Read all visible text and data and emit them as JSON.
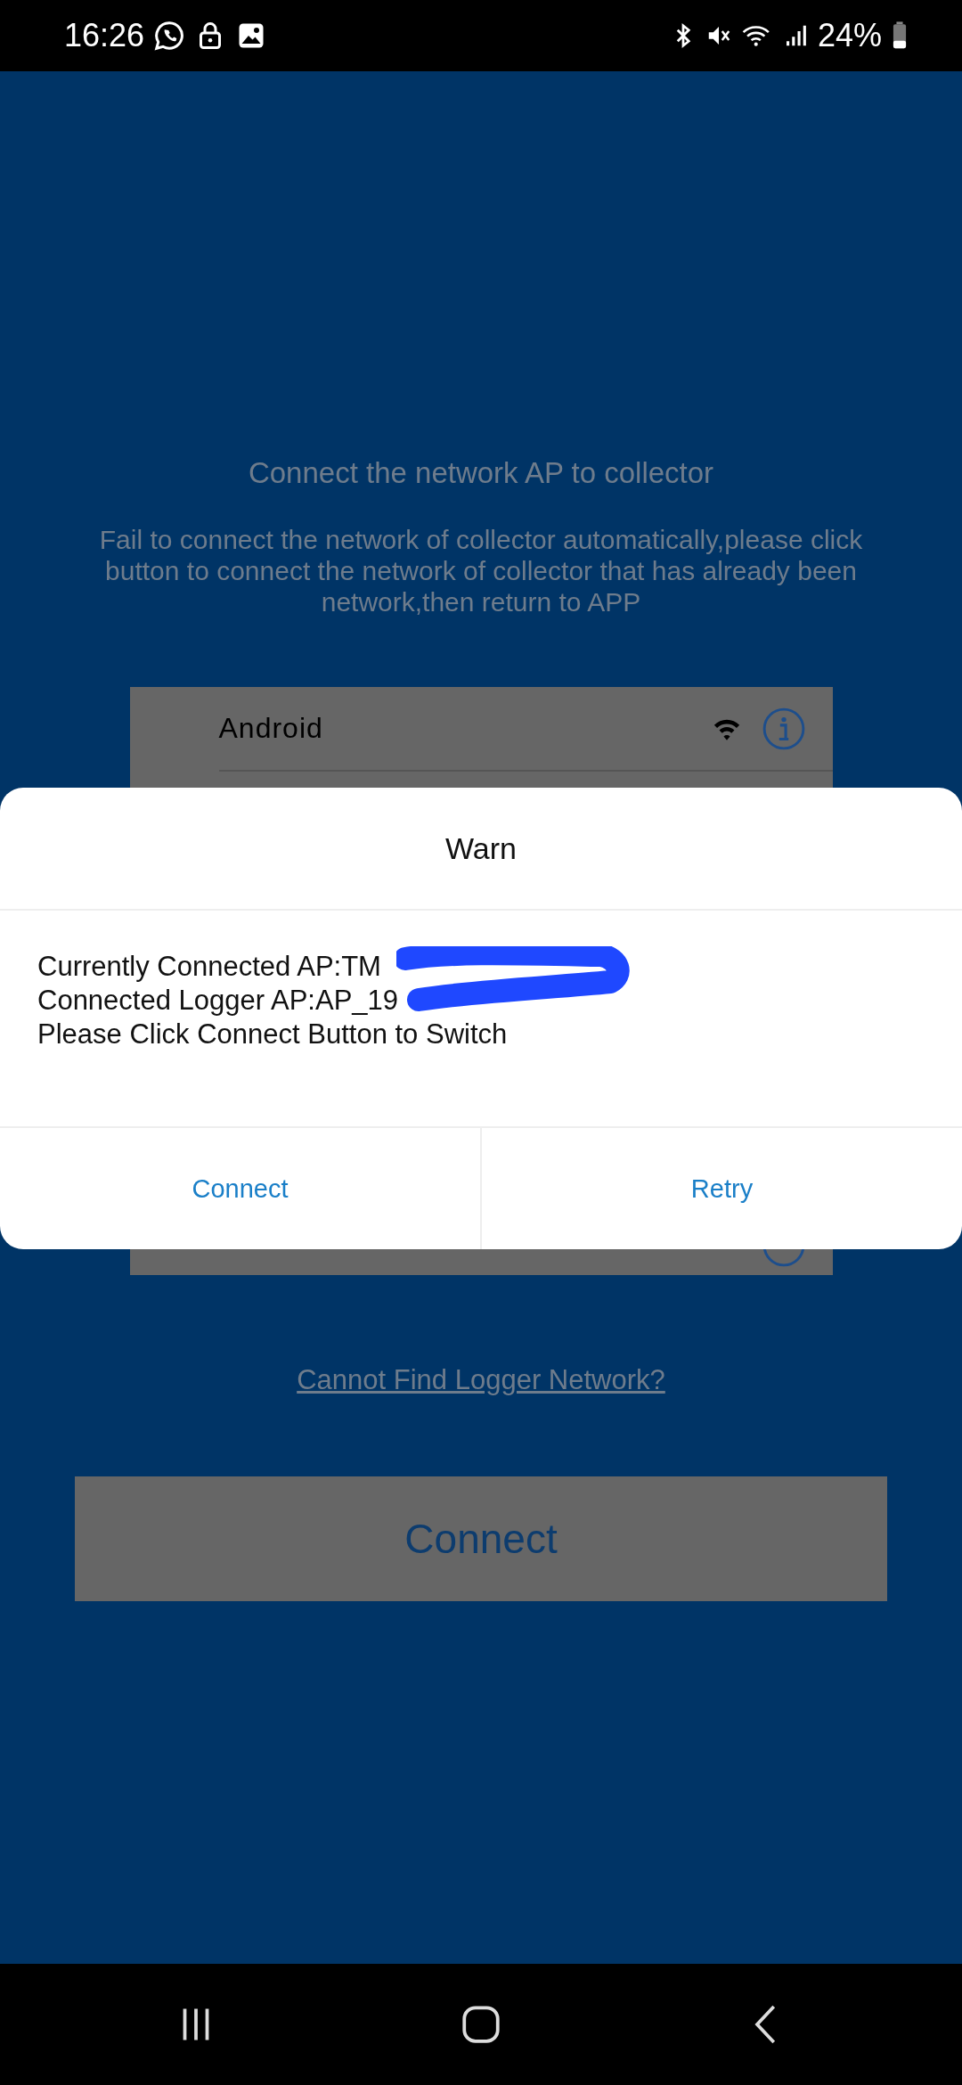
{
  "status_bar": {
    "time": "16:26",
    "battery": "24%"
  },
  "page": {
    "title": "Connect the network AP to collector",
    "description": "Fail to connect the network of collector automatically,please click button to connect the network of collector that has already been network,then return to APP"
  },
  "networks": [
    {
      "name": "Android"
    }
  ],
  "link": "Cannot Find Logger Network?",
  "connect_button": "Connect",
  "dialog": {
    "title": "Warn",
    "lines": [
      "Currently Connected AP:TM",
      "Connected Logger AP:AP_19",
      "Please Click Connect Button to Switch"
    ],
    "buttons": [
      "Connect",
      "Retry"
    ]
  }
}
